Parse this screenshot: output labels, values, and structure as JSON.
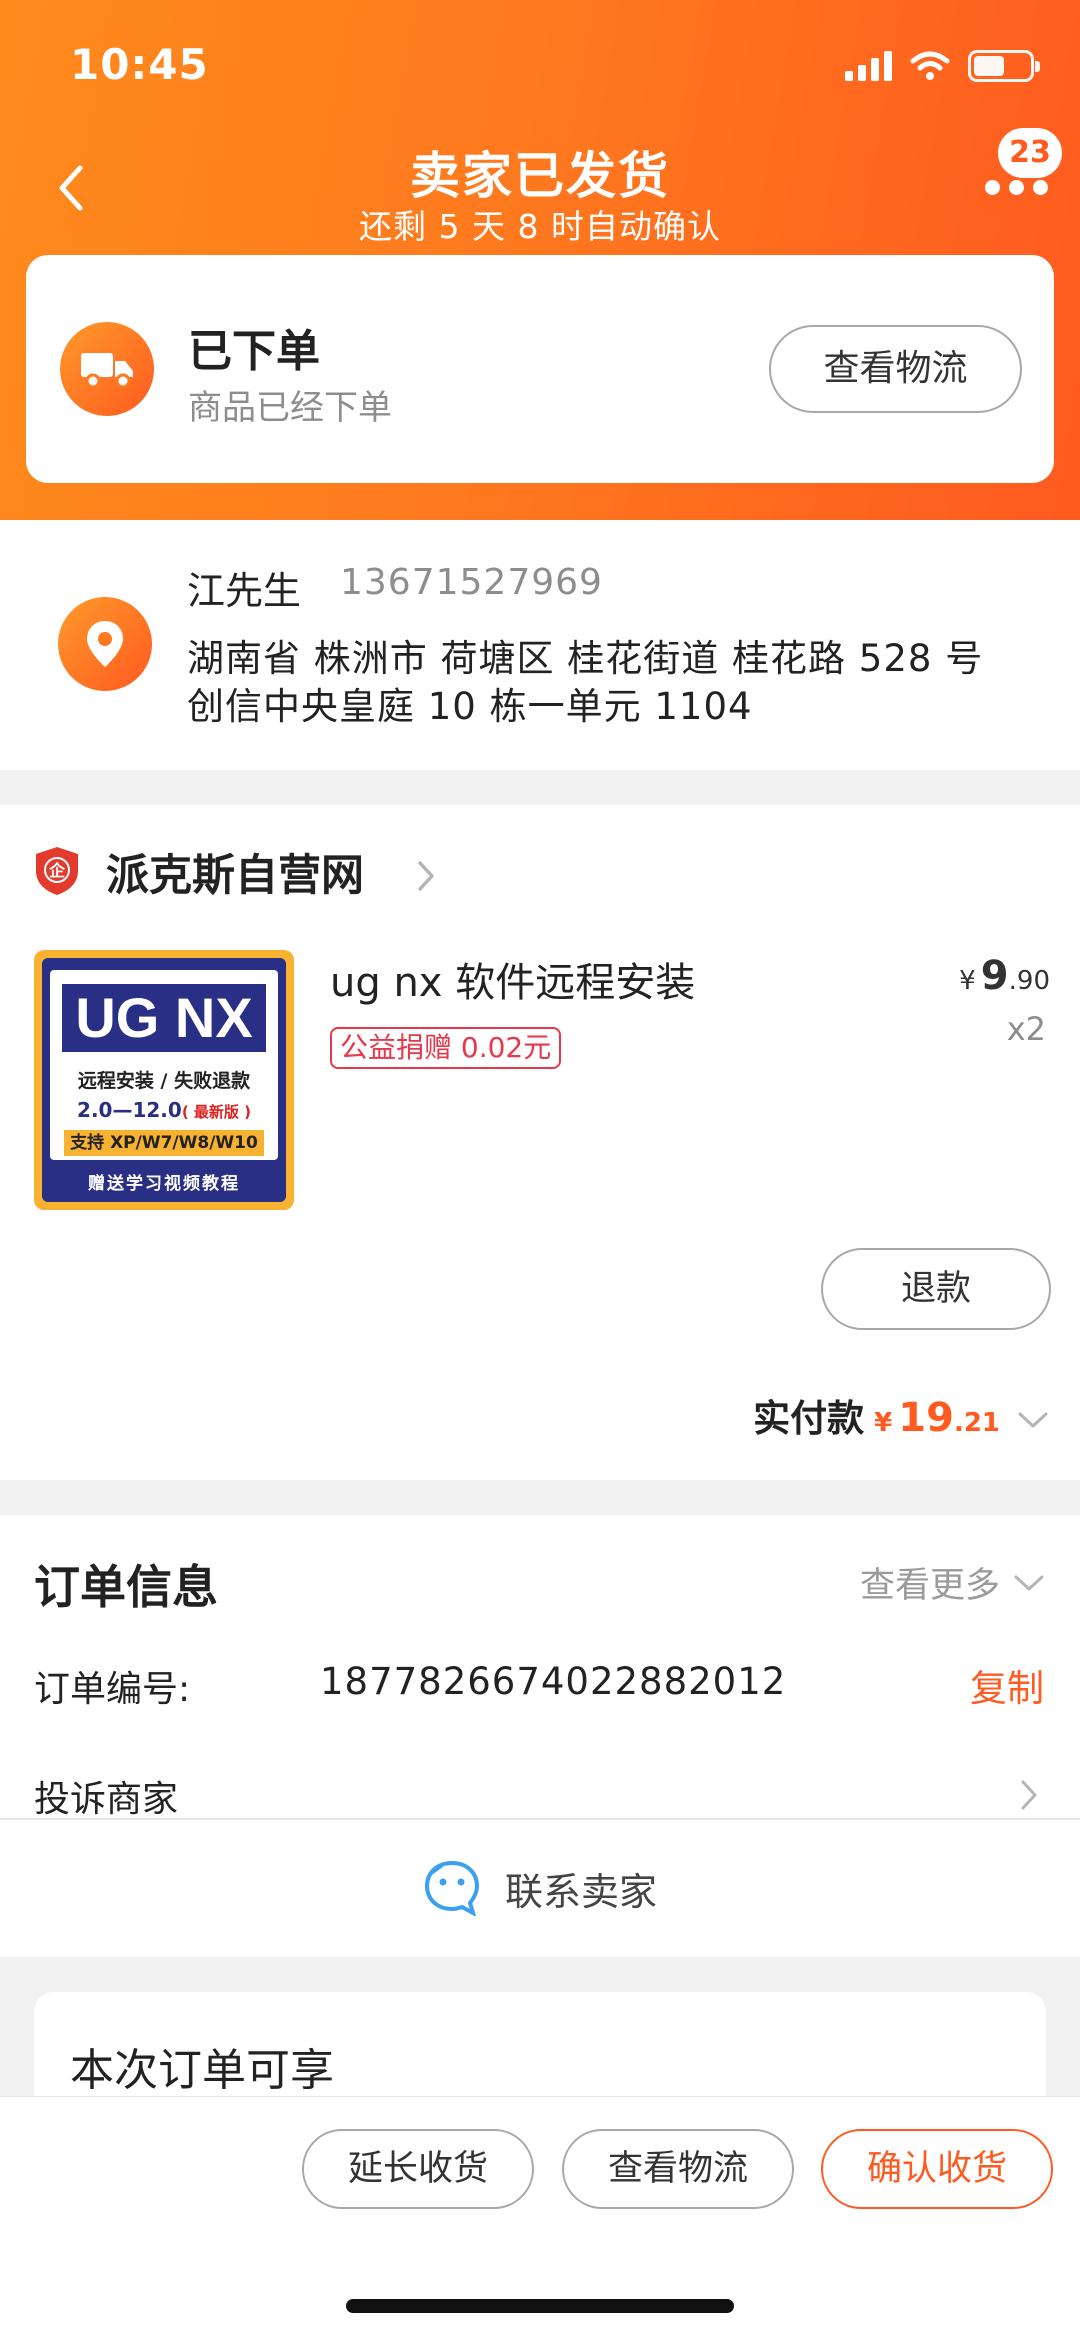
{
  "status_bar": {
    "time": "10:45"
  },
  "nav": {
    "title": "卖家已发货",
    "subtitle": "还剩 5 天 8 时自动确认",
    "badge": "23"
  },
  "status_card": {
    "title": "已下单",
    "subtitle": "商品已经下单",
    "button": "查看物流"
  },
  "address": {
    "name": "江先生",
    "phone": "13671527969",
    "line1": "湖南省 株洲市 荷塘区 桂花街道 桂花路 528 号",
    "line2": "创信中央皇庭 10 栋一单元 1104"
  },
  "shop": {
    "logo_text": "企",
    "name": "派克斯自营网",
    "product": {
      "title": "ug nx 软件远程安装",
      "tag": "公益捐赠 0.02元",
      "price_currency": "¥",
      "price_int": "9",
      "price_dec": ".90",
      "quantity": "x2",
      "thumb": {
        "title": "UG NX",
        "line1": "远程安装 / 失败退款",
        "line2": "2.0—12.0",
        "line2_note": "( 最新版 )",
        "line3": "支持 XP/W7/W8/W10",
        "line4": "赠送学习视频教程"
      }
    },
    "refund_button": "退款",
    "paid_label": "实付款",
    "paid_currency": "¥",
    "paid_int": "19",
    "paid_dec": ".21"
  },
  "order_info": {
    "title": "订单信息",
    "more": "查看更多",
    "number_label": "订单编号:",
    "number": "1877826674022882012",
    "copy": "复制",
    "complain": "投诉商家",
    "contact": "联系卖家"
  },
  "benefits": {
    "title": "本次订单可享"
  },
  "bottom_bar": {
    "extend": "延长收货",
    "logistics": "查看物流",
    "confirm": "确认收货"
  },
  "colors": {
    "accent": "#ff5a1f",
    "gradient_start": "#ff8a1c",
    "tag_red": "#e8364a"
  },
  "icons": [
    "back-icon",
    "more-icon",
    "truck-icon",
    "location-icon",
    "shop-logo-icon",
    "chevron-right-icon",
    "chevron-down-icon",
    "chat-icon"
  ]
}
